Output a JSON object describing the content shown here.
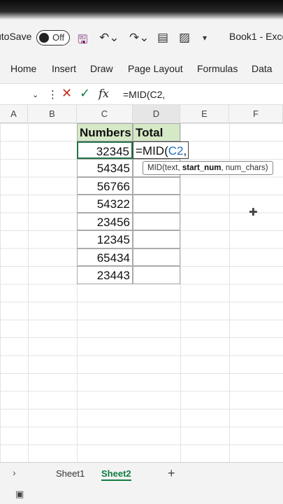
{
  "titlebar": {
    "autosave_label": "utoSave",
    "autosave_state": "Off",
    "book_title": "Book1 - Exce"
  },
  "ribbon": {
    "tabs": [
      "Home",
      "Insert",
      "Draw",
      "Page Layout",
      "Formulas",
      "Data"
    ]
  },
  "formula_bar": {
    "formula_text": "=MID(C2,"
  },
  "columns": [
    "A",
    "B",
    "C",
    "D",
    "E",
    "F"
  ],
  "table": {
    "headers": [
      "Numbers",
      "Total"
    ],
    "numbers": [
      "32345",
      "54345",
      "56766",
      "54322",
      "23456",
      "12345",
      "65434",
      "23443"
    ],
    "editing_cell": {
      "prefix": "=MID(",
      "ref": "C2",
      "suffix": ","
    }
  },
  "tooltip": {
    "prefix": "MID(text, ",
    "bold": "start_num",
    "suffix": ", num_chars)"
  },
  "sheets": [
    "Sheet1",
    "Sheet2"
  ],
  "active_sheet": "Sheet2",
  "colors": {
    "header_fill": "#d6e9c6",
    "accent": "#217346",
    "ref_color": "#1f6fc5"
  }
}
